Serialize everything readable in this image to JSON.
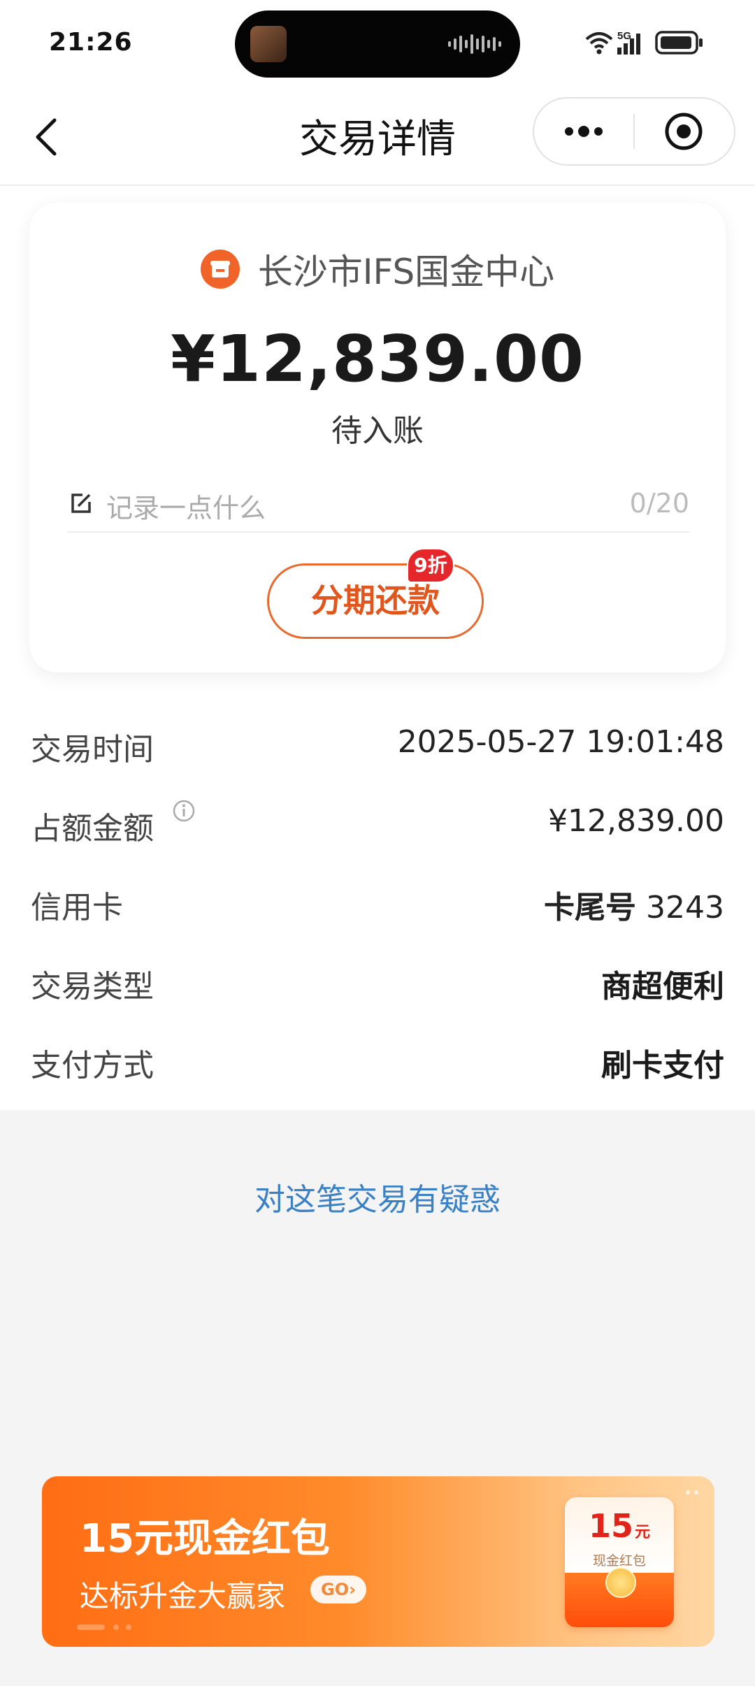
{
  "status_bar": {
    "time": "21:26",
    "network": "5G",
    "icons": [
      "wifi-icon",
      "signal-icon",
      "battery-icon"
    ]
  },
  "nav": {
    "title": "交易详情",
    "back_icon": "chevron-left-icon",
    "more_icon": "more-dots-icon",
    "close_icon": "target-close-icon"
  },
  "card": {
    "merchant_name": "长沙市IFS国金中心",
    "merchant_icon": "shop-icon",
    "amount": "¥12,839.00",
    "status": "待入账",
    "note": {
      "placeholder": "记录一点什么",
      "counter": "0/20",
      "icon": "edit-icon"
    },
    "installment_button": "分期还款",
    "discount_badge": "9折"
  },
  "details": [
    {
      "label": "交易时间",
      "value": "2025-05-27 19:01:48",
      "bold": false
    },
    {
      "label": "占额金额",
      "value": "¥12,839.00",
      "bold": false,
      "info": true
    },
    {
      "label": "信用卡",
      "value_prefix": "卡尾号",
      "value": "3243",
      "bold": false
    },
    {
      "label": "交易类型",
      "value": "商超便利",
      "bold": true
    },
    {
      "label": "支付方式",
      "value": "刷卡支付",
      "bold": true
    }
  ],
  "query_link": "对这笔交易有疑惑",
  "banner": {
    "title": "15元现金红包",
    "subtitle": "达标升金大赢家",
    "go_label": "GO",
    "envelope_amount": "15",
    "envelope_unit": "元",
    "envelope_label": "现金红包"
  },
  "colors": {
    "accent_orange": "#e0561c",
    "badge_red": "#e5262a",
    "link_blue": "#3a80c4"
  }
}
